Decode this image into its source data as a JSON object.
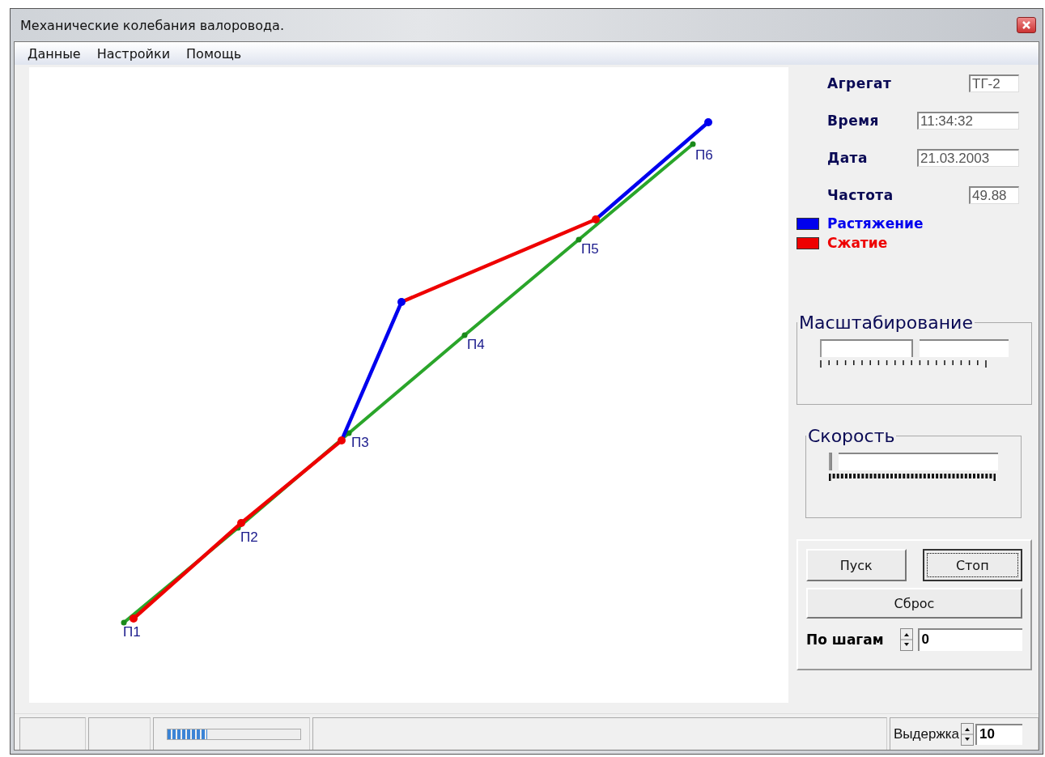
{
  "window": {
    "title": "Механические  колебания валоровода."
  },
  "menu": [
    "Данные",
    "Настройки",
    "Помощь"
  ],
  "shaft": {
    "points": [
      {
        "label": "П1"
      },
      {
        "label": "П2"
      },
      {
        "label": "П3"
      },
      {
        "label": "П4"
      },
      {
        "label": "П5"
      },
      {
        "label": "П6"
      }
    ],
    "segments": [
      {
        "kind": "compression"
      },
      {
        "kind": "compression"
      },
      {
        "kind": "tension"
      },
      {
        "kind": "compression"
      },
      {
        "kind": "tension"
      }
    ]
  },
  "info": [
    {
      "label": "Агрегат",
      "value": "ТГ-2"
    },
    {
      "label": "Время",
      "value": "11:34:32"
    },
    {
      "label": "Дата",
      "value": "21.03.2003"
    },
    {
      "label": "Частота",
      "value": "49.88"
    }
  ],
  "legend": [
    {
      "kind": "tension",
      "label": "Растяжение",
      "color": "#0000ee"
    },
    {
      "kind": "compression",
      "label": "Сжатие",
      "color": "#ee0000"
    }
  ],
  "scaling": {
    "title": "Масштабирование",
    "level": 0.5
  },
  "speed": {
    "title": "Скорость",
    "level": 0
  },
  "buttons": [
    {
      "label": "Пуск",
      "focused": false
    },
    {
      "label": "Стоп",
      "focused": true
    },
    {
      "label": "Сброс",
      "focused": false
    }
  ],
  "steps": {
    "label": "По шагам",
    "value": "0"
  },
  "status_bar": {
    "progress": {
      "level": 0.3
    },
    "delay": {
      "label": "Выдержка",
      "value": "10"
    }
  }
}
